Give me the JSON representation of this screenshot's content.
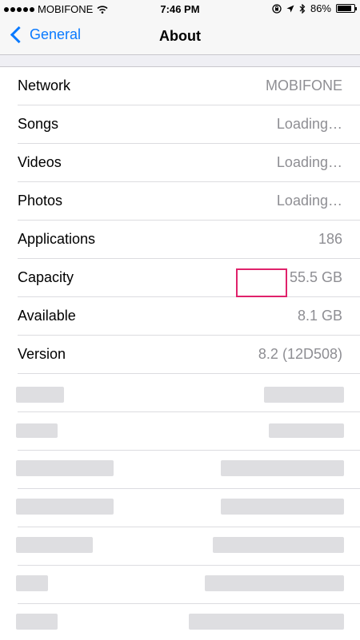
{
  "status_bar": {
    "carrier": "MOBIFONE",
    "time": "7:46 PM",
    "battery": "86%",
    "battery_level": 0.86,
    "icons": [
      "signal-dots-icon",
      "wifi-icon",
      "orientation-lock-icon",
      "location-arrow-icon",
      "bluetooth-icon",
      "battery-icon"
    ]
  },
  "nav": {
    "back_label": "General",
    "title": "About"
  },
  "rows": [
    {
      "label": "Network",
      "value": "MOBIFONE"
    },
    {
      "label": "Songs",
      "value": "Loading…"
    },
    {
      "label": "Videos",
      "value": "Loading…"
    },
    {
      "label": "Photos",
      "value": "Loading…"
    },
    {
      "label": "Applications",
      "value": "186"
    },
    {
      "label": "Capacity",
      "value": "55.5 GB"
    },
    {
      "label": "Available",
      "value": "8.1 GB"
    },
    {
      "label": "Version",
      "value": "8.2 (12D508)"
    }
  ],
  "colors": {
    "accent": "#0a7aff",
    "highlight": "#e0226b",
    "value_text": "#8e8e93"
  }
}
